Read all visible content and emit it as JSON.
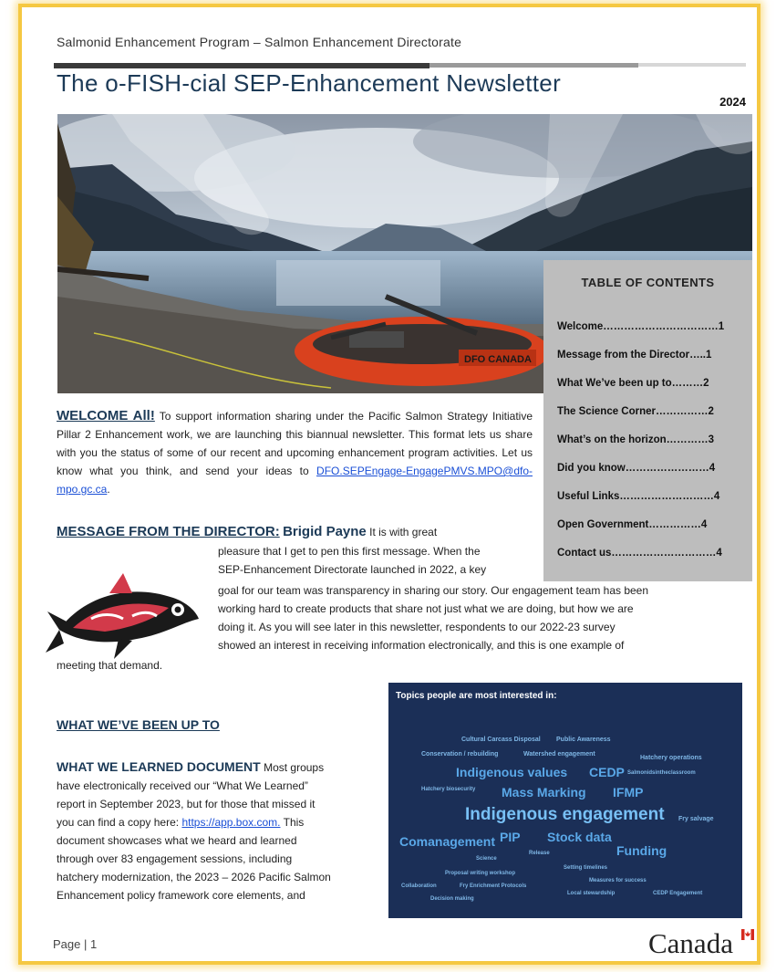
{
  "header": {
    "subtitle": "Salmonid Enhancement Program – Salmon Enhancement Directorate",
    "title": "The o-FISH-cial SEP-Enhancement Newsletter",
    "year": "2024"
  },
  "toc": {
    "heading": "TABLE OF CONTENTS",
    "items": [
      "Welcome……………………………1",
      "Message from the Director…..1",
      "What We’ve been up to………2",
      "The Science Corner……………2",
      "What’s on the horizon…………3",
      "Did you know……………………4",
      "Useful Links………………………4",
      "Open Government……………4",
      "Contact us…………………………4"
    ]
  },
  "welcome": {
    "heading": "WELCOME All!",
    "body": "To support information sharing under the Pacific Salmon Strategy Initiative Pillar 2 Enhancement work, we are launching this biannual newsletter. This format lets us share with you the status of some of our recent and upcoming enhancement program activities. Let us know what you think, and send your ideas to",
    "email": "DFO.SEPEngage-EngagePMVS.MPO@dfo-mpo.gc.ca"
  },
  "director": {
    "heading": "MESSAGE FROM THE DIRECTOR:",
    "name": "Brigid Payne",
    "lines": [
      "It is with great",
      "pleasure that I get to pen this first message. When the",
      "SEP-Enhancement Directorate launched in 2022, a key",
      "goal for our team was transparency in sharing our story. Our engagement team has been",
      "working hard to create products that share not just what we are doing, but how we are",
      "doing it. As you will see later in this newsletter, respondents to our 2022-23 survey",
      "showed an interest in receiving information electronically, and this is one example of",
      "meeting that demand."
    ]
  },
  "up_to": {
    "heading": "WHAT WE’VE BEEN UP TO",
    "sub_heading": "WHAT WE LEARNED DOCUMENT",
    "lines": [
      "Most groups",
      "have electronically received our “What We Learned”",
      "report in September 2023, but for those that missed it",
      "you can find a copy here:",
      "This",
      "document showcases what we heard and learned",
      "through over 83 engagement sessions, including",
      "hatchery modernization, the 2023 – 2026 Pacific Salmon",
      "Enhancement policy framework core elements, and"
    ],
    "link": "https://app.box.com."
  },
  "wordcloud": {
    "title": "Topics people are most interested in:",
    "words": [
      "Cultural Carcass Disposal",
      "Public Awareness",
      "Conservation / rebuilding",
      "Watershed engagement",
      "Hatchery operations",
      "Indigenous values",
      "CEDP",
      "Salmonidsintheclassroom",
      "Hatchery biosecurity",
      "Mass Marking",
      "IFMP",
      "Indigenous engagement",
      "Fry salvage",
      "Comanagement",
      "PIP",
      "Stock data",
      "Funding",
      "Release",
      "Science",
      "Setting timelines",
      "Proposal writing workshop",
      "Measures for success",
      "Collaboration",
      "Fry Enrichment Protocols",
      "Local stewardship",
      "CEDP Engagement",
      "Decision making"
    ]
  },
  "footer": {
    "page_label": "Page | 1",
    "wordmark": "Canada"
  },
  "colors": {
    "heading_blue": "#1c3a57",
    "frame_yellow": "#f5c842",
    "toc_gray": "#bdbdbd",
    "cloud_bg": "#1b2f57"
  }
}
